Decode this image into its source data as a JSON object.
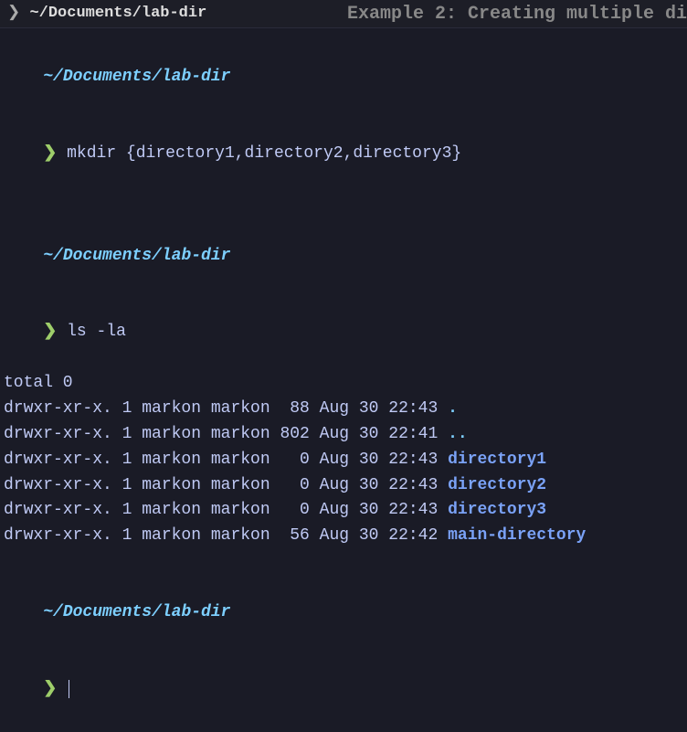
{
  "titlebar": {
    "prompt_char": "❯",
    "path": "~/Documents/lab-dir",
    "bg_text": "Example 2: Creating multiple di"
  },
  "session": {
    "cwd": "~/Documents/lab-dir",
    "prompt": "❯",
    "cmd1": "mkdir {directory1,directory2,directory3}",
    "cmd2": "ls -la",
    "ls_output": {
      "total": "total 0",
      "rows": [
        {
          "perm": "drwxr-xr-x.",
          "links": "1",
          "user": "markon",
          "group": "markon",
          "size": " 88",
          "date": "Aug 30 22:43",
          "name": ".",
          "class": "dir-dot"
        },
        {
          "perm": "drwxr-xr-x.",
          "links": "1",
          "user": "markon",
          "group": "markon",
          "size": "802",
          "date": "Aug 30 22:41",
          "name": "..",
          "class": "dir-dot"
        },
        {
          "perm": "drwxr-xr-x.",
          "links": "1",
          "user": "markon",
          "group": "markon",
          "size": "  0",
          "date": "Aug 30 22:43",
          "name": "directory1",
          "class": "dir-name"
        },
        {
          "perm": "drwxr-xr-x.",
          "links": "1",
          "user": "markon",
          "group": "markon",
          "size": "  0",
          "date": "Aug 30 22:43",
          "name": "directory2",
          "class": "dir-name"
        },
        {
          "perm": "drwxr-xr-x.",
          "links": "1",
          "user": "markon",
          "group": "markon",
          "size": "  0",
          "date": "Aug 30 22:43",
          "name": "directory3",
          "class": "dir-name"
        },
        {
          "perm": "drwxr-xr-x.",
          "links": "1",
          "user": "markon",
          "group": "markon",
          "size": " 56",
          "date": "Aug 30 22:42",
          "name": "main-directory",
          "class": "dir-name"
        }
      ]
    }
  }
}
